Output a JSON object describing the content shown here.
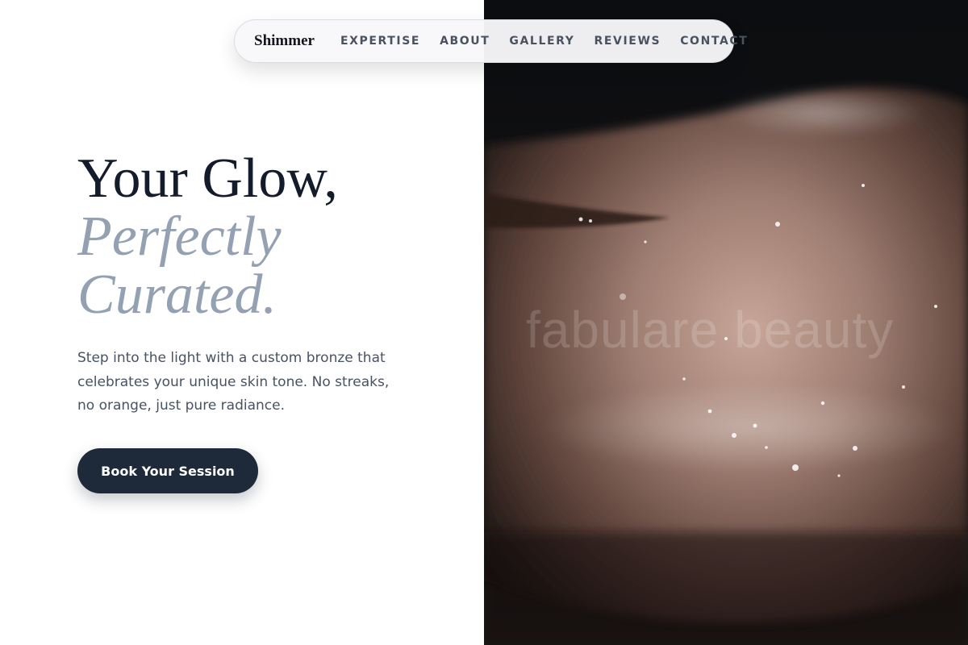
{
  "nav": {
    "brand": "Shimmer",
    "links": [
      "EXPERTISE",
      "ABOUT",
      "GALLERY",
      "REVIEWS",
      "CONTACT"
    ]
  },
  "hero": {
    "headline_line1": "Your Glow,",
    "headline_line2": "Perfectly",
    "headline_line3": "Curated.",
    "subcopy": "Step into the light with a custom bronze that celebrates your unique skin tone. No streaks, no orange, just pure radiance.",
    "cta_label": "Book Your Session",
    "photo_watermark": "fabulare beauty"
  },
  "colors": {
    "accent_navy": "#1e2939",
    "accent_gray_blue": "#94a1b3",
    "text_dark": "#141b2a",
    "body_text": "#475263"
  }
}
